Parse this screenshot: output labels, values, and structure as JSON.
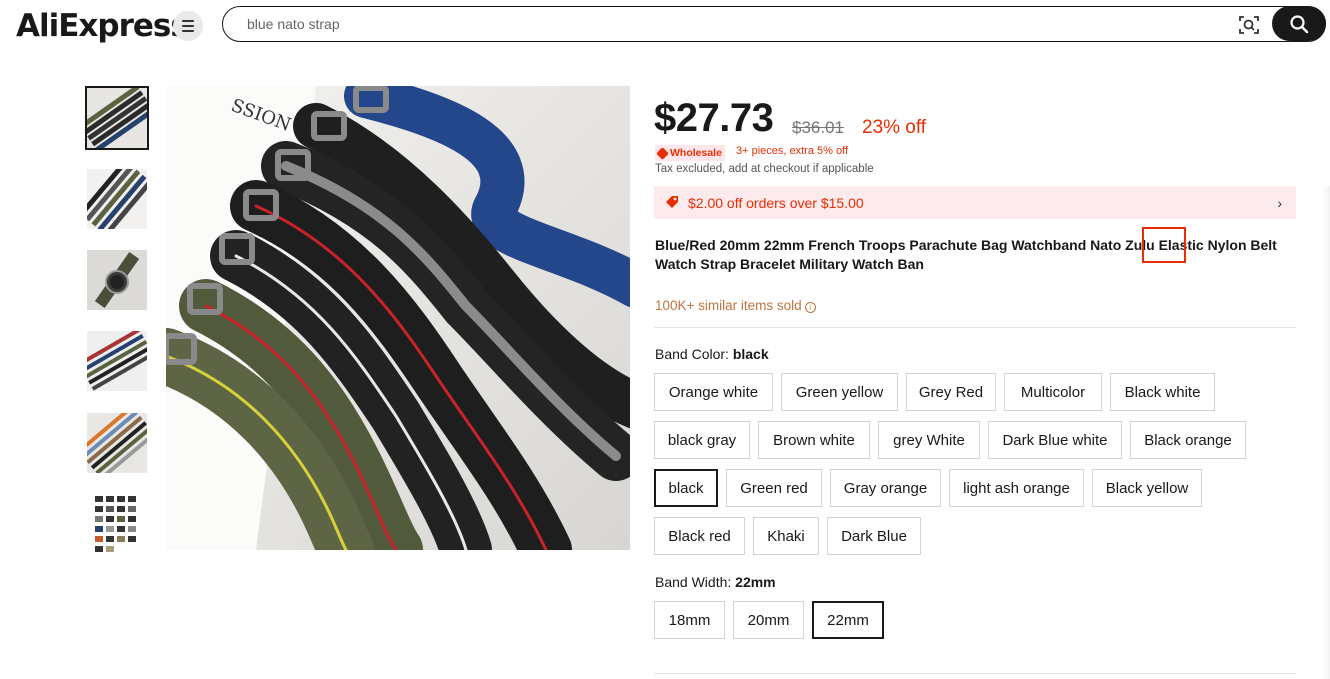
{
  "header": {
    "logo_text": "AliExpress",
    "search_placeholder": "blue nato strap"
  },
  "gallery": {
    "thumb_count": 6,
    "selected_index": 0
  },
  "price": {
    "current": "$27.73",
    "original": "$36.01",
    "discount": "23% off",
    "wholesale_label": "Wholesale",
    "wholesale_note": "3+ pieces, extra 5% off",
    "tax_note": "Tax excluded, add at checkout if applicable"
  },
  "coupon": {
    "text": "$2.00 off orders over $15.00"
  },
  "product": {
    "title": "Blue/Red 20mm 22mm French Troops Parachute Bag Watchband Nato Zulu Elastic Nylon Belt Watch Strap Bracelet Military Watch Ban",
    "sold": "100K+ similar items sold"
  },
  "band_color": {
    "label": "Band Color: ",
    "value": "black",
    "options": [
      "Orange white",
      "Green yellow",
      "Grey Red",
      "Multicolor",
      "Black white",
      "black gray",
      "Brown white",
      "grey White",
      "Dark Blue white",
      "Black orange",
      "black",
      "Green red",
      "Gray orange",
      "light ash orange",
      "Black yellow",
      "Black red",
      "Khaki",
      "Dark Blue"
    ],
    "selected": "black"
  },
  "band_width": {
    "label": "Band Width: ",
    "value": "22mm",
    "options": [
      "18mm",
      "20mm",
      "22mm"
    ],
    "selected": "22mm"
  },
  "colors": {
    "accent_red": "#e62e04",
    "text_dark": "#191919",
    "sold_orange": "#c0733c",
    "coupon_bg": "#fdeaec"
  }
}
